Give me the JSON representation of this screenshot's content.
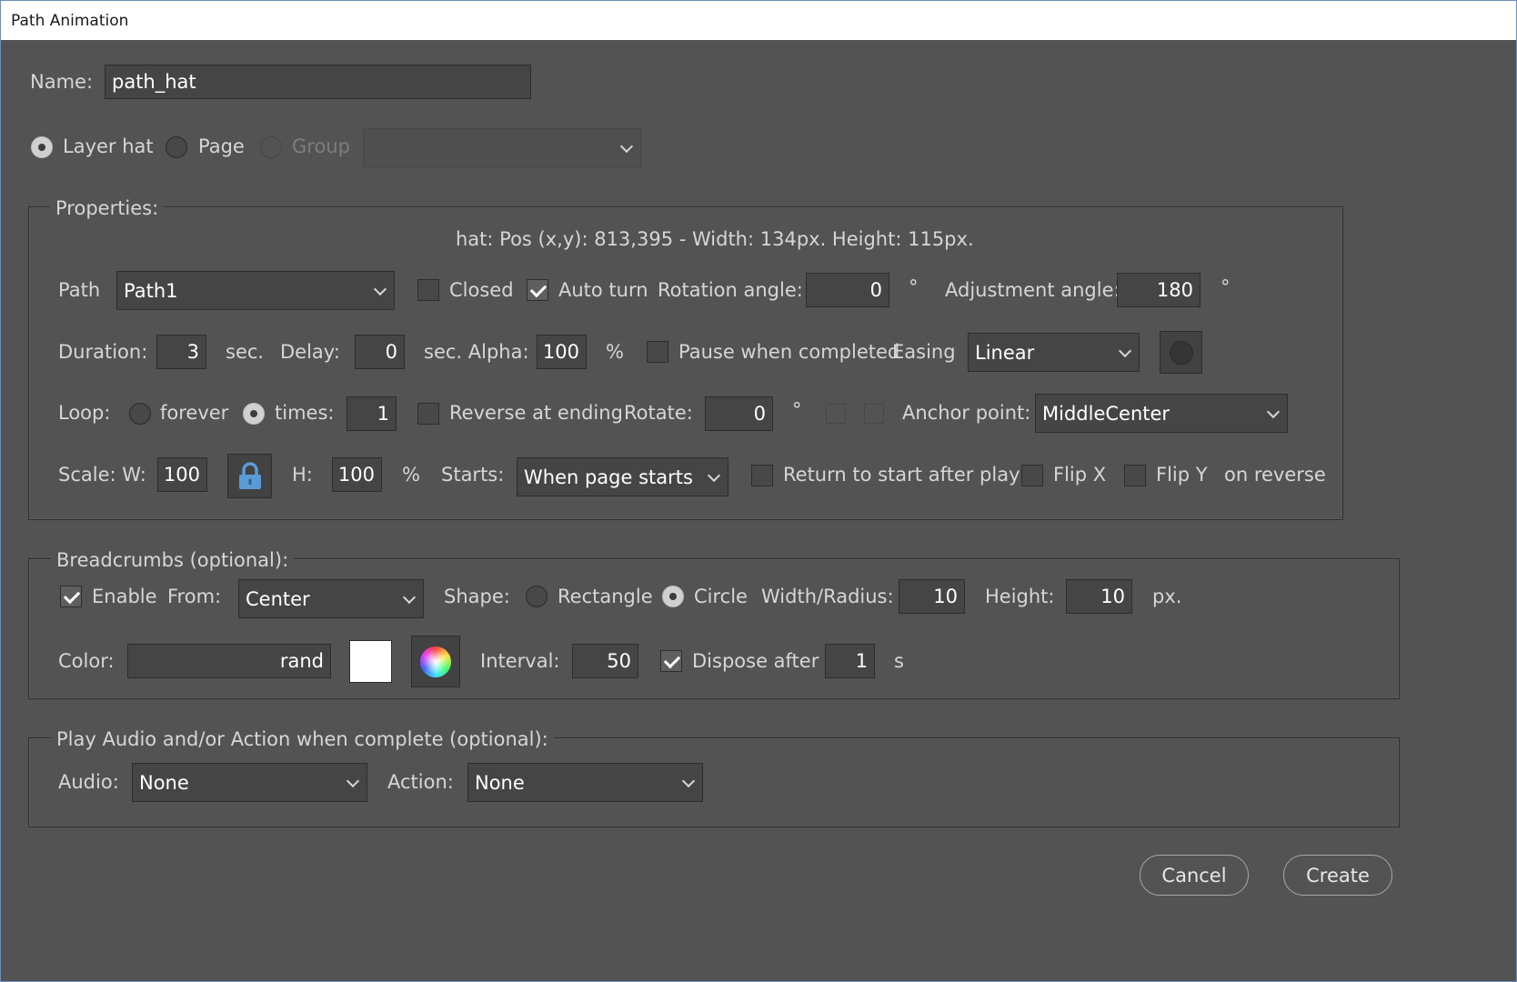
{
  "window": {
    "title": "Path Animation"
  },
  "name": {
    "label": "Name:",
    "value": "path_hat"
  },
  "target": {
    "options": [
      {
        "label": "Layer hat",
        "selected": true,
        "enabled": true
      },
      {
        "label": "Page",
        "selected": false,
        "enabled": true
      },
      {
        "label": "Group",
        "selected": false,
        "enabled": false
      }
    ],
    "group_select": ""
  },
  "properties": {
    "legend": "Properties:",
    "info": "hat: Pos (x,y): 813,395 - Width: 134px. Height: 115px.",
    "path": {
      "label": "Path",
      "value": "Path1"
    },
    "closed": {
      "label": "Closed",
      "checked": false
    },
    "auto_turn": {
      "label": "Auto turn",
      "checked": true
    },
    "rotation_angle": {
      "label": "Rotation angle:",
      "value": "0",
      "unit": "°"
    },
    "adjustment_angle": {
      "label": "Adjustment angle:",
      "value": "180",
      "unit": "°"
    },
    "duration": {
      "label": "Duration:",
      "value": "3",
      "unit": "sec."
    },
    "delay": {
      "label": "Delay:",
      "value": "0",
      "unit": "sec. Alpha:"
    },
    "alpha": {
      "value": "100",
      "unit": "%"
    },
    "pause_when_completed": {
      "label": "Pause when completed",
      "checked": false
    },
    "easing": {
      "label": "Easing",
      "value": "Linear"
    },
    "loop": {
      "label": "Loop:",
      "forever_label": "forever",
      "times_label": "times:",
      "times_value": "1",
      "mode": "times"
    },
    "reverse_at_ending": {
      "label": "Reverse at ending",
      "checked": false
    },
    "rotate": {
      "label": "Rotate:",
      "value": "0",
      "unit": "°"
    },
    "anchor_point": {
      "label": "Anchor point:",
      "value": "MiddleCenter"
    },
    "scale": {
      "w_label": "Scale: W:",
      "w_value": "100",
      "h_label": "H:",
      "h_value": "100",
      "unit": "%"
    },
    "starts": {
      "label": "Starts:",
      "value": "When page starts"
    },
    "return_to_start": {
      "label": "Return to start after play",
      "checked": false
    },
    "flip_x": {
      "label": "Flip X",
      "checked": false
    },
    "flip_y": {
      "label": "Flip Y",
      "checked": false
    },
    "on_reverse": "on reverse"
  },
  "breadcrumbs": {
    "legend": "Breadcrumbs (optional):",
    "enable": {
      "label": "Enable",
      "checked": true
    },
    "from": {
      "label": "From:",
      "value": "Center"
    },
    "shape": {
      "label": "Shape:",
      "rectangle_label": "Rectangle",
      "circle_label": "Circle",
      "selected": "circle"
    },
    "width_radius": {
      "label": "Width/Radius:",
      "value": "10"
    },
    "height": {
      "label": "Height:",
      "value": "10",
      "unit": "px."
    },
    "color": {
      "label": "Color:",
      "value": "rand",
      "swatch": "#ffffff"
    },
    "interval": {
      "label": "Interval:",
      "value": "50"
    },
    "dispose_after": {
      "label": "Dispose after",
      "checked": true,
      "value": "1",
      "unit": "s"
    }
  },
  "complete": {
    "legend": "Play Audio and/or Action when complete (optional):",
    "audio": {
      "label": "Audio:",
      "value": "None"
    },
    "action": {
      "label": "Action:",
      "value": "None"
    }
  },
  "buttons": {
    "cancel": "Cancel",
    "create": "Create"
  }
}
